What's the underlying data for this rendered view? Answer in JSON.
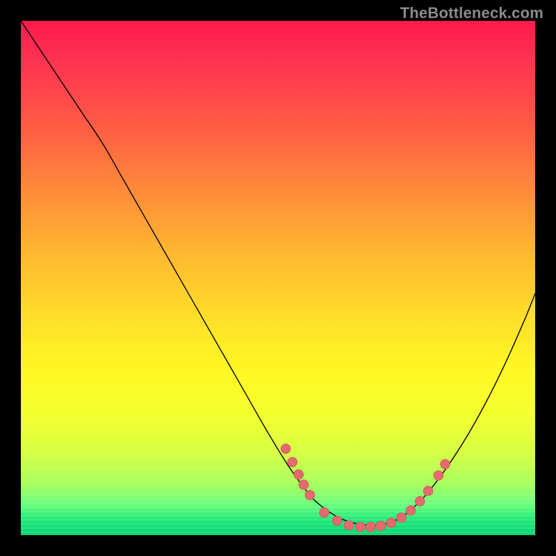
{
  "watermark": "TheBottleneck.com",
  "colors": {
    "dot_fill": "#e46a6f",
    "dot_stroke": "#c94f55",
    "curve": "#000000"
  },
  "chart_data": {
    "type": "line",
    "title": "",
    "xlabel": "",
    "ylabel": "",
    "xlim": [
      0,
      100
    ],
    "ylim": [
      0,
      100
    ],
    "series": [
      {
        "name": "curve",
        "x": [
          0,
          4,
          8,
          12,
          16,
          20,
          24,
          28,
          32,
          36,
          40,
          44,
          48,
          52,
          56,
          58,
          60,
          62,
          64,
          66,
          70,
          74,
          78,
          82,
          86,
          90,
          94,
          98,
          100
        ],
        "y": [
          100,
          94,
          88,
          82,
          76,
          69,
          62,
          55,
          48,
          41,
          34,
          27,
          20,
          13.5,
          8,
          6,
          4.5,
          3.3,
          2.6,
          2.1,
          2.0,
          3.5,
          7,
          12,
          18,
          25,
          33,
          42,
          47
        ]
      }
    ],
    "markers": {
      "name": "highlighted-points",
      "points": [
        {
          "x": 51.5,
          "y": 16.8
        },
        {
          "x": 52.8,
          "y": 14.2
        },
        {
          "x": 54.0,
          "y": 11.8
        },
        {
          "x": 55.0,
          "y": 9.8
        },
        {
          "x": 56.2,
          "y": 7.8
        },
        {
          "x": 59.0,
          "y": 4.4
        },
        {
          "x": 61.5,
          "y": 2.8
        },
        {
          "x": 63.8,
          "y": 1.9
        },
        {
          "x": 66.0,
          "y": 1.6
        },
        {
          "x": 68.0,
          "y": 1.6
        },
        {
          "x": 70.0,
          "y": 1.8
        },
        {
          "x": 72.0,
          "y": 2.4
        },
        {
          "x": 74.0,
          "y": 3.4
        },
        {
          "x": 75.8,
          "y": 4.8
        },
        {
          "x": 77.6,
          "y": 6.6
        },
        {
          "x": 79.2,
          "y": 8.6
        },
        {
          "x": 81.2,
          "y": 11.6
        },
        {
          "x": 82.5,
          "y": 13.8
        }
      ],
      "radius": 7
    },
    "green_band_fraction": 0.08
  }
}
